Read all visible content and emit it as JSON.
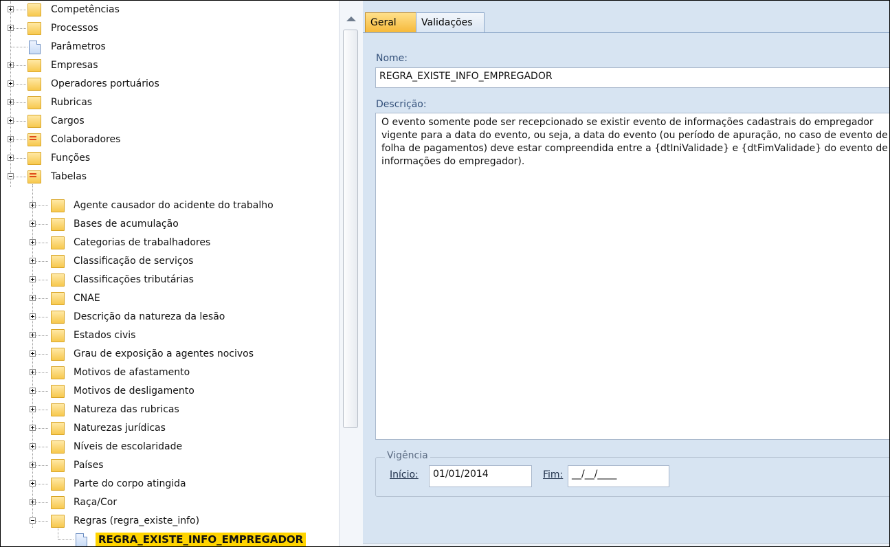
{
  "tree": {
    "items": [
      {
        "label": "Competências",
        "icon": "folder-icon"
      },
      {
        "label": "Processos",
        "icon": "folder-icon"
      },
      {
        "label": "Parâmetros",
        "icon": "document-icon"
      },
      {
        "label": "Empresas",
        "icon": "folder-icon"
      },
      {
        "label": "Operadores portuários",
        "icon": "folder-icon"
      },
      {
        "label": "Rubricas",
        "icon": "folder-icon"
      },
      {
        "label": "Cargos",
        "icon": "folder-icon"
      },
      {
        "label": "Colaboradores",
        "icon": "folder-open-icon"
      },
      {
        "label": "Funções",
        "icon": "folder-icon"
      },
      {
        "label": "Tabelas",
        "icon": "folder-open-icon"
      }
    ],
    "children": [
      {
        "label": "Agente causador do acidente do trabalho"
      },
      {
        "label": "Bases de acumulação"
      },
      {
        "label": "Categorias de trabalhadores"
      },
      {
        "label": "Classificação de serviços"
      },
      {
        "label": "Classificações tributárias"
      },
      {
        "label": "CNAE"
      },
      {
        "label": "Descrição da natureza da lesão"
      },
      {
        "label": "Estados civis"
      },
      {
        "label": "Grau de exposição a agentes nocivos"
      },
      {
        "label": "Motivos de afastamento"
      },
      {
        "label": "Motivos de desligamento"
      },
      {
        "label": "Natureza das rubricas"
      },
      {
        "label": "Naturezas jurídicas"
      },
      {
        "label": "Níveis de escolaridade"
      },
      {
        "label": "Países"
      },
      {
        "label": "Parte do corpo atingida"
      },
      {
        "label": "Raça/Cor"
      },
      {
        "label": "Regras (regra_existe_info)"
      }
    ],
    "selected": {
      "label": "REGRA_EXISTE_INFO_EMPREGADOR"
    }
  },
  "tabs": {
    "geral": "Geral",
    "validacoes": "Validações"
  },
  "form": {
    "nome_label": "Nome:",
    "nome_value": "REGRA_EXISTE_INFO_EMPREGADOR",
    "descricao_label": "Descrição:",
    "descricao_value": "O evento somente pode ser recepcionado se existir evento de informações cadastrais do empregador vigente para a data do evento, ou seja, a data do evento (ou período de apuração, no caso de evento de folha de pagamentos) deve estar compreendida entre a {dtIniValidade} e {dtFimValidade} do evento de informações do empregador).",
    "vigencia_label": "Vigência",
    "inicio_label": "Início:",
    "inicio_value": "01/01/2014",
    "fim_label": "Fim:",
    "fim_value": "__/__/____"
  },
  "colors": {
    "selection": "#ffd400",
    "tab_active": "#f6b93a",
    "panel_bg": "#d7e4f2"
  }
}
